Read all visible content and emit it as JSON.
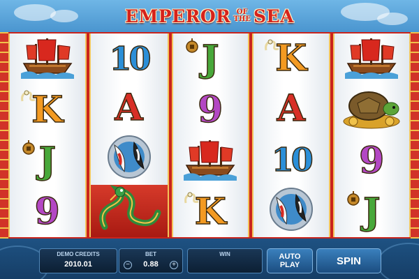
{
  "header": {
    "title_main": "EMPEROR",
    "title_of": "OF",
    "title_the": "THE",
    "title_sea": "SEA"
  },
  "reels": [
    [
      "ship",
      "K",
      "J",
      "9"
    ],
    [
      "10",
      "A",
      "koi",
      "dragon"
    ],
    [
      "J",
      "9",
      "ship",
      "K"
    ],
    [
      "K",
      "A",
      "10",
      "koi"
    ],
    [
      "ship",
      "turtle",
      "9",
      "J"
    ]
  ],
  "controls": {
    "credits_label": "DEMO CREDITS",
    "credits_value": "2010.01",
    "bet_label": "BET",
    "bet_value": "0.88",
    "bet_minus": "−",
    "bet_plus": "+",
    "win_label": "WIN",
    "win_value": "",
    "autoplay_label_1": "AUTO",
    "autoplay_label_2": "PLAY",
    "spin_label": "SPIN"
  }
}
